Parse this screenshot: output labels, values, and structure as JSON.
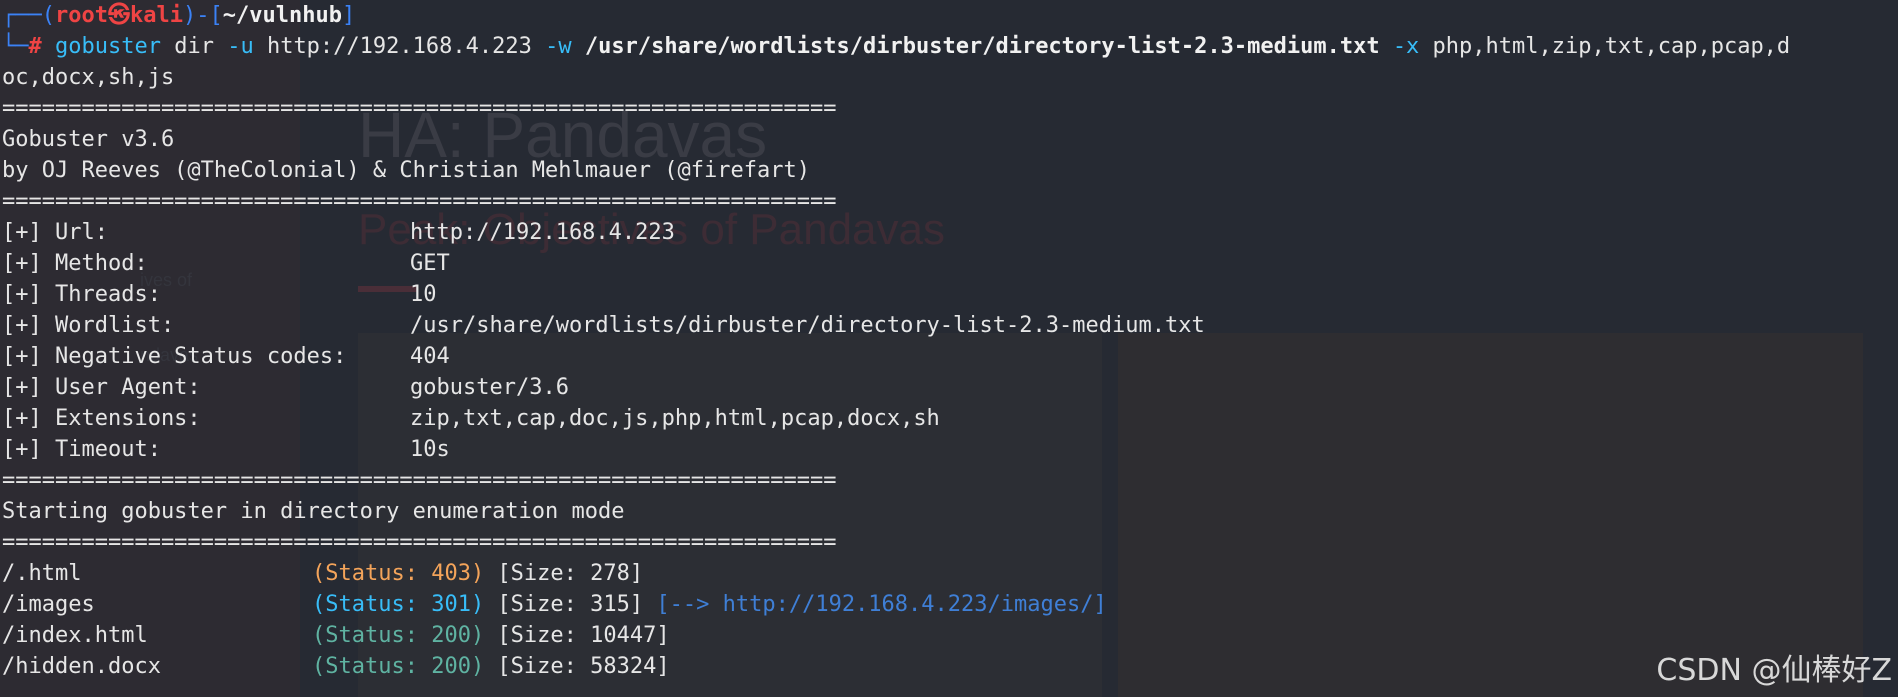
{
  "prompt": {
    "corner_top": "┌──",
    "open": "(",
    "user": "root",
    "at": "㉿",
    "host": "kali",
    "close": ")-[",
    "cwd": "~/vulnhub",
    "end": "]",
    "corner_bottom": "└─",
    "hash": "# "
  },
  "command": {
    "tool": "gobuster",
    "p1": " dir ",
    "flag_u": "-u",
    "url": " http://192.168.4.223 ",
    "flag_w": "-w",
    "wordlist": " /usr/share/wordlists/dirbuster/directory-list-2.3-medium.txt ",
    "flag_x": "-x",
    "exts": " php,html,zip,txt,cap,pcap,d",
    "wrap": "oc,docx,sh,js"
  },
  "separator": "===============================================================",
  "banner": {
    "version": "Gobuster v3.6",
    "authors": "by OJ Reeves (@TheColonial) & Christian Mehlmauer (@firefart)"
  },
  "config": [
    {
      "key": "[+] Url:",
      "value": "http://192.168.4.223"
    },
    {
      "key": "[+] Method:",
      "value": "GET"
    },
    {
      "key": "[+] Threads:",
      "value": "10"
    },
    {
      "key": "[+] Wordlist:",
      "value": "/usr/share/wordlists/dirbuster/directory-list-2.3-medium.txt"
    },
    {
      "key": "[+] Negative Status codes:",
      "value": "404"
    },
    {
      "key": "[+] User Agent:",
      "value": "gobuster/3.6"
    },
    {
      "key": "[+] Extensions:",
      "value": "zip,txt,cap,doc,js,php,html,pcap,docx,sh"
    },
    {
      "key": "[+] Timeout:",
      "value": "10s"
    }
  ],
  "start_msg": "Starting gobuster in directory enumeration mode",
  "results": [
    {
      "path": "/.html",
      "status": "(Status: 403)",
      "size": " [Size: 278]",
      "redirect": ""
    },
    {
      "path": "/images",
      "status": "(Status: 301)",
      "size": " [Size: 315]",
      "redirect": " [--> http://192.168.4.223/images/]"
    },
    {
      "path": "/index.html",
      "status": "(Status: 200)",
      "size": " [Size: 10447]",
      "redirect": ""
    },
    {
      "path": "/hidden.docx",
      "status": "(Status: 200)",
      "size": " [Size: 58324]",
      "redirect": ""
    }
  ],
  "colors": {
    "status_403": "#f4a45a",
    "status_301": "#38bdf8",
    "status_200": "#5fb3a2"
  },
  "background": {
    "title": "HA: Pandavas",
    "subtitle": "Peak: Objectives of Pandavas",
    "side1": "ives of",
    "side2": "ndavas"
  },
  "watermark": "CSDN @仙棒好Z"
}
